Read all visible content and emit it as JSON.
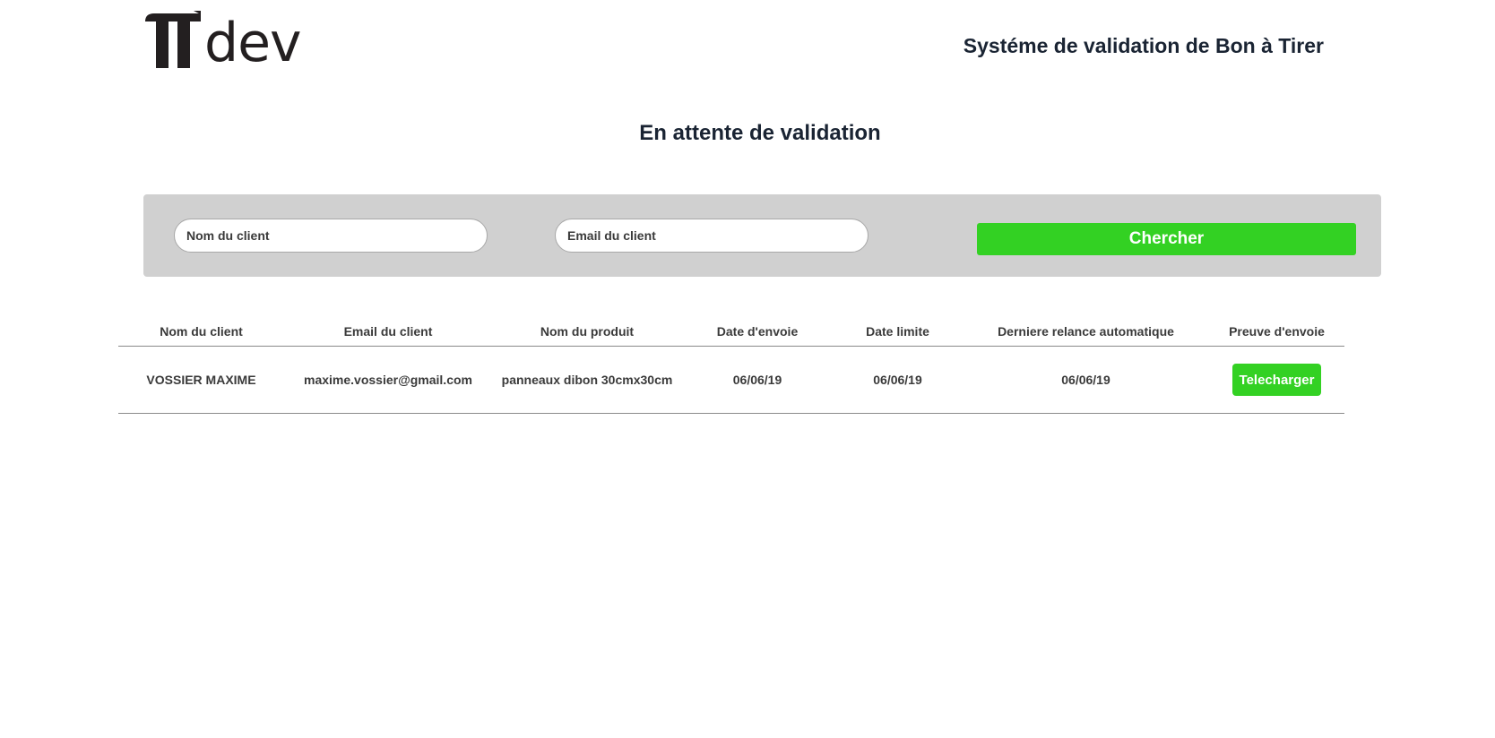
{
  "header": {
    "logo_text": "dev",
    "app_title": "Systéme de validation de Bon à Tirer"
  },
  "page": {
    "heading": "En attente de validation"
  },
  "search": {
    "name_placeholder": "Nom du client",
    "name_value": "",
    "email_placeholder": "Email du client",
    "email_value": "",
    "button_label": "Chercher"
  },
  "table": {
    "columns": [
      "Nom du client",
      "Email du client",
      "Nom du produit",
      "Date d'envoie",
      "Date limite",
      "Derniere relance automatique",
      "Preuve d'envoie"
    ],
    "rows": [
      {
        "client_name": "VOSSIER MAXIME",
        "client_email": "maxime.vossier@gmail.com",
        "product_name": "panneaux dibon 30cmx30cm",
        "sent_date": "06/06/19",
        "deadline": "06/06/19",
        "last_reminder": "06/06/19",
        "proof_button_label": "Telecharger"
      }
    ]
  },
  "colors": {
    "accent_green": "#33d123",
    "heading_text": "#1a2433",
    "panel_background": "#d0d0d0"
  },
  "icons": {
    "logo": "pi-symbol-logo"
  }
}
